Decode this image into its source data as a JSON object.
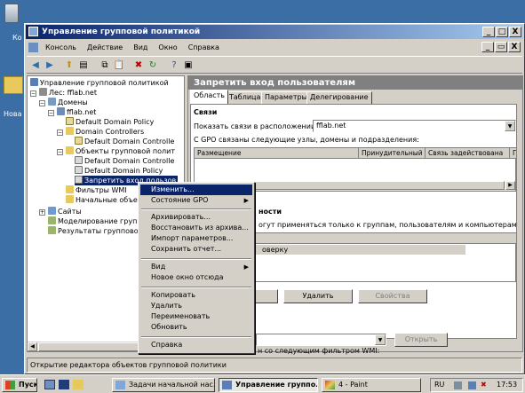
{
  "desktop": {
    "icons": [
      {
        "label": "Ко",
        "icon": "recycle-bin-icon"
      },
      {
        "label": "Нова",
        "icon": "folder-icon"
      }
    ]
  },
  "window": {
    "title": "Управление групповой политикой",
    "buttons": {
      "minimize": "_",
      "maximize": "□",
      "close": "X"
    },
    "inner_buttons": {
      "minimize": "_",
      "restore": "▭",
      "close": "X"
    }
  },
  "menubar": {
    "items": [
      "Консоль",
      "Действие",
      "Вид",
      "Окно",
      "Справка"
    ]
  },
  "toolbar": {
    "icons": [
      "back-icon",
      "forward-icon",
      "up-icon",
      "show-tree-icon",
      "copy-icon",
      "paste-icon",
      "delete-icon",
      "refresh-icon",
      "help-icon",
      "properties-icon"
    ]
  },
  "tree": {
    "nodes": [
      {
        "label": "Управление групповой политикой",
        "icon": "gpm-icon"
      },
      {
        "label": "Лес: fflab.net",
        "icon": "forest-icon"
      },
      {
        "label": "Домены",
        "icon": "domains-icon"
      },
      {
        "label": "fflab.net",
        "icon": "domain-icon"
      },
      {
        "label": "Default Domain Policy",
        "icon": "gpo-link-icon"
      },
      {
        "label": "Domain Controllers",
        "icon": "ou-icon"
      },
      {
        "label": "Default Domain Controlle",
        "icon": "gpo-link-icon"
      },
      {
        "label": "Объекты групповой полит",
        "icon": "gpo-folder-icon"
      },
      {
        "label": "Default Domain Controlle",
        "icon": "gpo-icon"
      },
      {
        "label": "Default Domain Policy",
        "icon": "gpo-icon"
      },
      {
        "label": "Запретить вход пользов",
        "icon": "gpo-icon"
      },
      {
        "label": "Фильтры WMI",
        "icon": "wmi-icon"
      },
      {
        "label": "Начальные объекты",
        "icon": "starter-gpo-icon"
      },
      {
        "label": "Сайты",
        "icon": "sites-icon"
      },
      {
        "label": "Моделирование группов",
        "icon": "modeling-icon"
      },
      {
        "label": "Результаты группово",
        "icon": "results-icon"
      }
    ]
  },
  "right_panel": {
    "title": "Запретить вход пользователям",
    "tabs": [
      "Область",
      "Таблица",
      "Параметры",
      "Делегирование"
    ],
    "links_section": {
      "heading": "Связи",
      "show_links_label": "Показать связи в расположении:",
      "location_value": "fflab.net",
      "linked_text": "С GPO связаны следующие узлы, домены и подразделения:",
      "columns": [
        "Размещение",
        "Принудительный",
        "Связь задействована",
        "П"
      ]
    },
    "security_section": {
      "heading_partial": "ности",
      "text_partial": "огут применяться только к группам, пользователям и компьютерам:",
      "row_partial": "оверку",
      "buttons": {
        "add": "",
        "remove": "Удалить",
        "properties": "Свойства"
      }
    },
    "wmi_section": {
      "text_partial": "н со следующим фильтром WMI:",
      "select_value": "",
      "open_button": "Открыть"
    }
  },
  "context_menu": {
    "items": [
      {
        "label": "Изменить...",
        "selected": true
      },
      {
        "label": "Состояние GPO",
        "submenu": true
      },
      {
        "label": "Архивировать..."
      },
      {
        "label": "Восстановить из архива..."
      },
      {
        "label": "Импорт параметров..."
      },
      {
        "label": "Сохранить отчет..."
      },
      {
        "label": "Вид",
        "submenu": true
      },
      {
        "label": "Новое окно отсюда"
      },
      {
        "label": "Копировать"
      },
      {
        "label": "Удалить"
      },
      {
        "label": "Переименовать"
      },
      {
        "label": "Обновить"
      },
      {
        "label": "Справка"
      }
    ]
  },
  "statusbar": {
    "text": "Открытие редактора объектов групповой политики"
  },
  "taskbar": {
    "start_label": "Пуск",
    "items": [
      {
        "label": "Задачи начальной нас...",
        "active": false
      },
      {
        "label": "Управление группо...",
        "active": true
      },
      {
        "label": "4 - Paint",
        "active": false
      }
    ],
    "language": "RU",
    "clock": "17:53"
  },
  "colors": {
    "desktop": "#3a6ea5",
    "title_active": "#0a246a",
    "menu_highlight": "#0a246a",
    "panel_header": "#808080"
  }
}
